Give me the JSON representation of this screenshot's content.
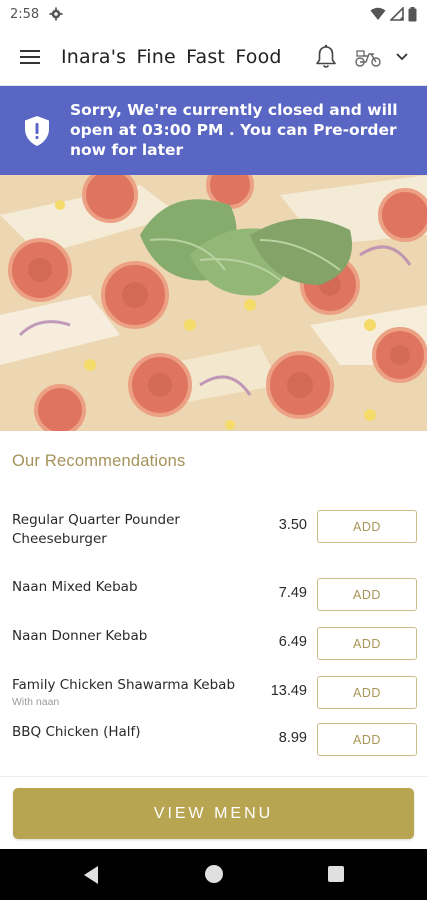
{
  "status_bar": {
    "time": "2:58",
    "icons": [
      "gear-icon",
      "wifi-icon",
      "signal-icon",
      "battery-icon"
    ]
  },
  "app_bar": {
    "title": "Inara's  Fine Fast Food",
    "icons": [
      "menu-icon",
      "bell-icon",
      "scooter-icon",
      "chevron-down-icon"
    ]
  },
  "closed_banner": {
    "message": "Sorry, We're currently closed and will open at 03:00 PM . You can Pre-order now for later",
    "background": "#5a66c4",
    "icon": "shield-alert-icon"
  },
  "recommendations": {
    "title": "Our Recommendations",
    "items": [
      {
        "name": "Regular Quarter Pounder Cheeseburger",
        "subtitle": "",
        "price": "3.50",
        "button": "ADD"
      },
      {
        "name": "Naan Mixed Kebab",
        "subtitle": "",
        "price": "7.49",
        "button": "ADD"
      },
      {
        "name": "Naan Donner Kebab",
        "subtitle": "",
        "price": "6.49",
        "button": "ADD"
      },
      {
        "name": "Family Chicken Shawarma Kebab",
        "subtitle": "With naan",
        "price": "13.49",
        "button": "ADD"
      },
      {
        "name": "BBQ Chicken (Half)",
        "subtitle": "",
        "price": "8.99",
        "button": "ADD"
      }
    ]
  },
  "footer": {
    "view_menu_label": "VIEW MENU",
    "accent": "#b8a551"
  },
  "nav_bar": {
    "icons": [
      "back-icon",
      "home-icon",
      "recents-icon"
    ]
  }
}
